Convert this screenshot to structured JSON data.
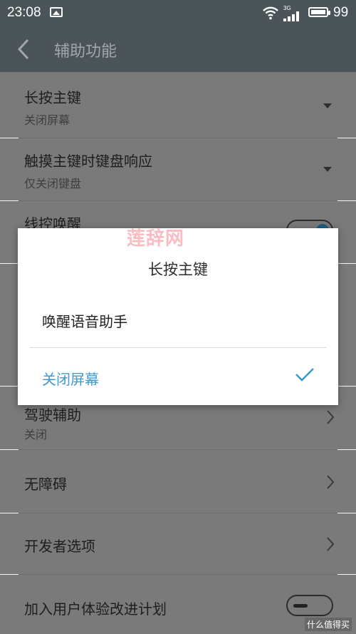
{
  "status": {
    "time": "23:08",
    "network": "3G",
    "battery": "99"
  },
  "header": {
    "title": "辅助功能"
  },
  "settings": [
    {
      "title": "长按主键",
      "subtitle": "关闭屏幕",
      "control": "dropdown"
    },
    {
      "title": "触摸主键时键盘响应",
      "subtitle": "仅关闭键盘",
      "control": "dropdown"
    },
    {
      "title": "线控唤醒",
      "control": "toggle-on"
    },
    {
      "title": "驾驶辅助",
      "subtitle": "关闭",
      "control": "chevron"
    },
    {
      "title": "无障碍",
      "control": "chevron"
    },
    {
      "title": "开发者选项",
      "control": "chevron"
    },
    {
      "title": "加入用户体验改进计划",
      "control": "toggle-off"
    }
  ],
  "dialog": {
    "title": "长按主键",
    "options": [
      {
        "label": "唤醒语音助手",
        "selected": false
      },
      {
        "label": "关闭屏幕",
        "selected": true
      }
    ],
    "accent_color": "#3d9bd1"
  },
  "watermark": "莲辞网",
  "corner_watermark": "什么值得买"
}
